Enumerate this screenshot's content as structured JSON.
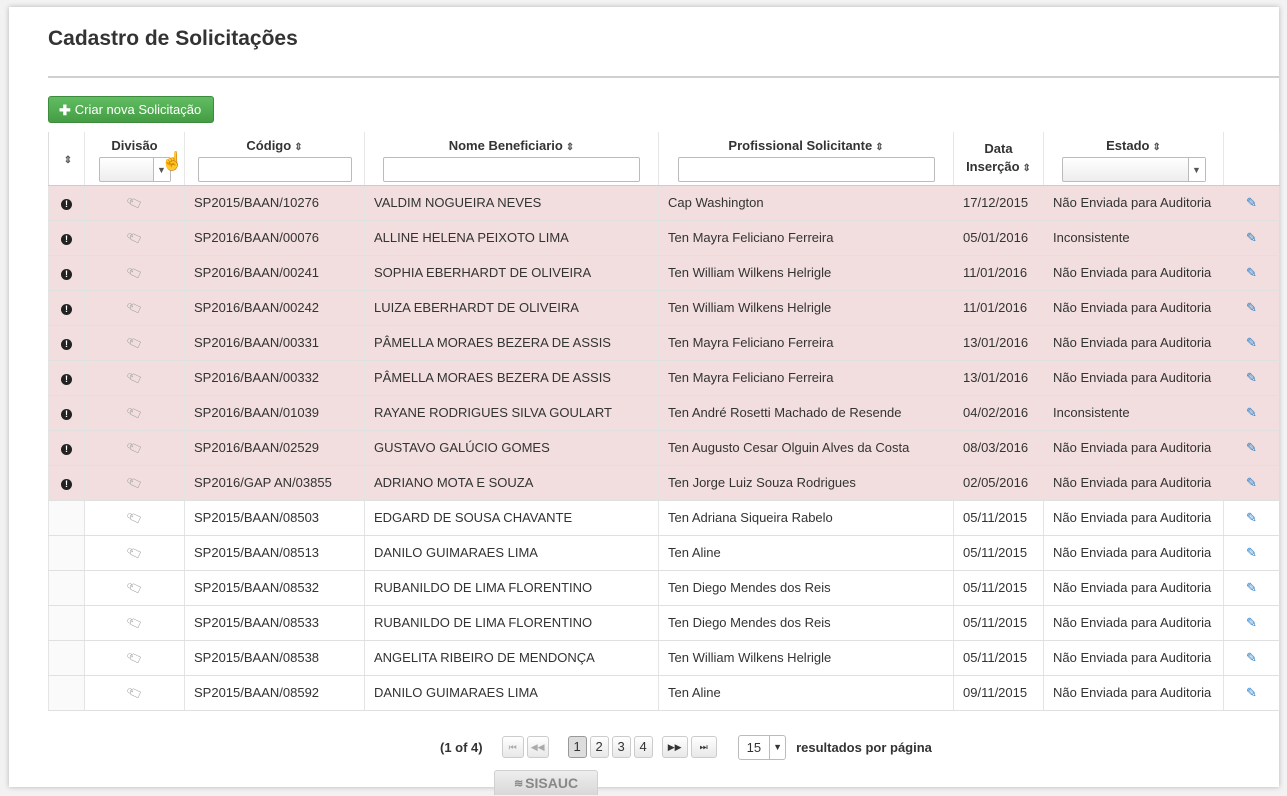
{
  "page": {
    "title": "Cadastro de Solicitações"
  },
  "toolbar": {
    "new_button_label": "Criar nova Solicitação",
    "new_button_icon": "plus-icon"
  },
  "table": {
    "columns": {
      "divisao": "Divisão",
      "codigo": "Código",
      "nome": "Nome Beneficiario",
      "profissional": "Profissional Solicitante",
      "data_line1": "Data",
      "data_line2": "Inserção",
      "estado": "Estado"
    },
    "rows": [
      {
        "alert": true,
        "codigo": "SP2015/BAAN/10276",
        "nome": "VALDIM NOGUEIRA NEVES",
        "profissional": "Cap Washington",
        "data": "17/12/2015",
        "estado": "Não Enviada para Auditoria"
      },
      {
        "alert": true,
        "codigo": "SP2016/BAAN/00076",
        "nome": "ALLINE HELENA PEIXOTO LIMA",
        "profissional": "Ten Mayra Feliciano Ferreira",
        "data": "05/01/2016",
        "estado": "Inconsistente"
      },
      {
        "alert": true,
        "codigo": "SP2016/BAAN/00241",
        "nome": "SOPHIA EBERHARDT DE OLIVEIRA",
        "profissional": "Ten William Wilkens Helrigle",
        "data": "11/01/2016",
        "estado": "Não Enviada para Auditoria"
      },
      {
        "alert": true,
        "codigo": "SP2016/BAAN/00242",
        "nome": "LUIZA EBERHARDT DE OLIVEIRA",
        "profissional": "Ten William Wilkens Helrigle",
        "data": "11/01/2016",
        "estado": "Não Enviada para Auditoria"
      },
      {
        "alert": true,
        "codigo": "SP2016/BAAN/00331",
        "nome": "PÂMELLA MORAES BEZERA DE ASSIS",
        "profissional": "Ten Mayra Feliciano Ferreira",
        "data": "13/01/2016",
        "estado": "Não Enviada para Auditoria"
      },
      {
        "alert": true,
        "codigo": "SP2016/BAAN/00332",
        "nome": "PÂMELLA MORAES BEZERA DE ASSIS",
        "profissional": "Ten Mayra Feliciano Ferreira",
        "data": "13/01/2016",
        "estado": "Não Enviada para Auditoria"
      },
      {
        "alert": true,
        "codigo": "SP2016/BAAN/01039",
        "nome": "RAYANE RODRIGUES SILVA GOULART",
        "profissional": "Ten André Rosetti Machado de Resende",
        "data": "04/02/2016",
        "estado": "Inconsistente"
      },
      {
        "alert": true,
        "codigo": "SP2016/BAAN/02529",
        "nome": "GUSTAVO GALÚCIO GOMES",
        "profissional": "Ten Augusto Cesar Olguin Alves da Costa",
        "data": "08/03/2016",
        "estado": "Não Enviada para Auditoria"
      },
      {
        "alert": true,
        "codigo": "SP2016/GAP AN/03855",
        "nome": "ADRIANO MOTA E SOUZA",
        "profissional": "Ten Jorge Luiz Souza Rodrigues",
        "data": "02/05/2016",
        "estado": "Não Enviada para Auditoria"
      },
      {
        "alert": false,
        "codigo": "SP2015/BAAN/08503",
        "nome": "EDGARD DE SOUSA CHAVANTE",
        "profissional": "Ten Adriana Siqueira Rabelo",
        "data": "05/11/2015",
        "estado": "Não Enviada para Auditoria"
      },
      {
        "alert": false,
        "codigo": "SP2015/BAAN/08513",
        "nome": "DANILO GUIMARAES LIMA",
        "profissional": "Ten Aline",
        "data": "05/11/2015",
        "estado": "Não Enviada para Auditoria"
      },
      {
        "alert": false,
        "codigo": "SP2015/BAAN/08532",
        "nome": "RUBANILDO DE LIMA FLORENTINO",
        "profissional": "Ten Diego Mendes dos Reis",
        "data": "05/11/2015",
        "estado": "Não Enviada para Auditoria"
      },
      {
        "alert": false,
        "codigo": "SP2015/BAAN/08533",
        "nome": "RUBANILDO DE LIMA FLORENTINO",
        "profissional": "Ten Diego Mendes dos Reis",
        "data": "05/11/2015",
        "estado": "Não Enviada para Auditoria"
      },
      {
        "alert": false,
        "codigo": "SP2015/BAAN/08538",
        "nome": "ANGELITA RIBEIRO DE MENDONÇA",
        "profissional": "Ten William Wilkens Helrigle",
        "data": "05/11/2015",
        "estado": "Não Enviada para Auditoria"
      },
      {
        "alert": false,
        "codigo": "SP2015/BAAN/08592",
        "nome": "DANILO GUIMARAES LIMA",
        "profissional": "Ten Aline",
        "data": "09/11/2015",
        "estado": "Não Enviada para Auditoria"
      }
    ],
    "colors": {
      "alert_row_bg": "#f2dede",
      "edit_icon": "#2a7ec4",
      "new_button": "#5cb85c"
    }
  },
  "pagination": {
    "info": "(1 of 4)",
    "pages": [
      "1",
      "2",
      "3",
      "4"
    ],
    "current_page": "1",
    "rows_per_page": "15",
    "rows_per_page_label": "resultados por página"
  },
  "footer": {
    "logo_text": "SISAUC"
  }
}
